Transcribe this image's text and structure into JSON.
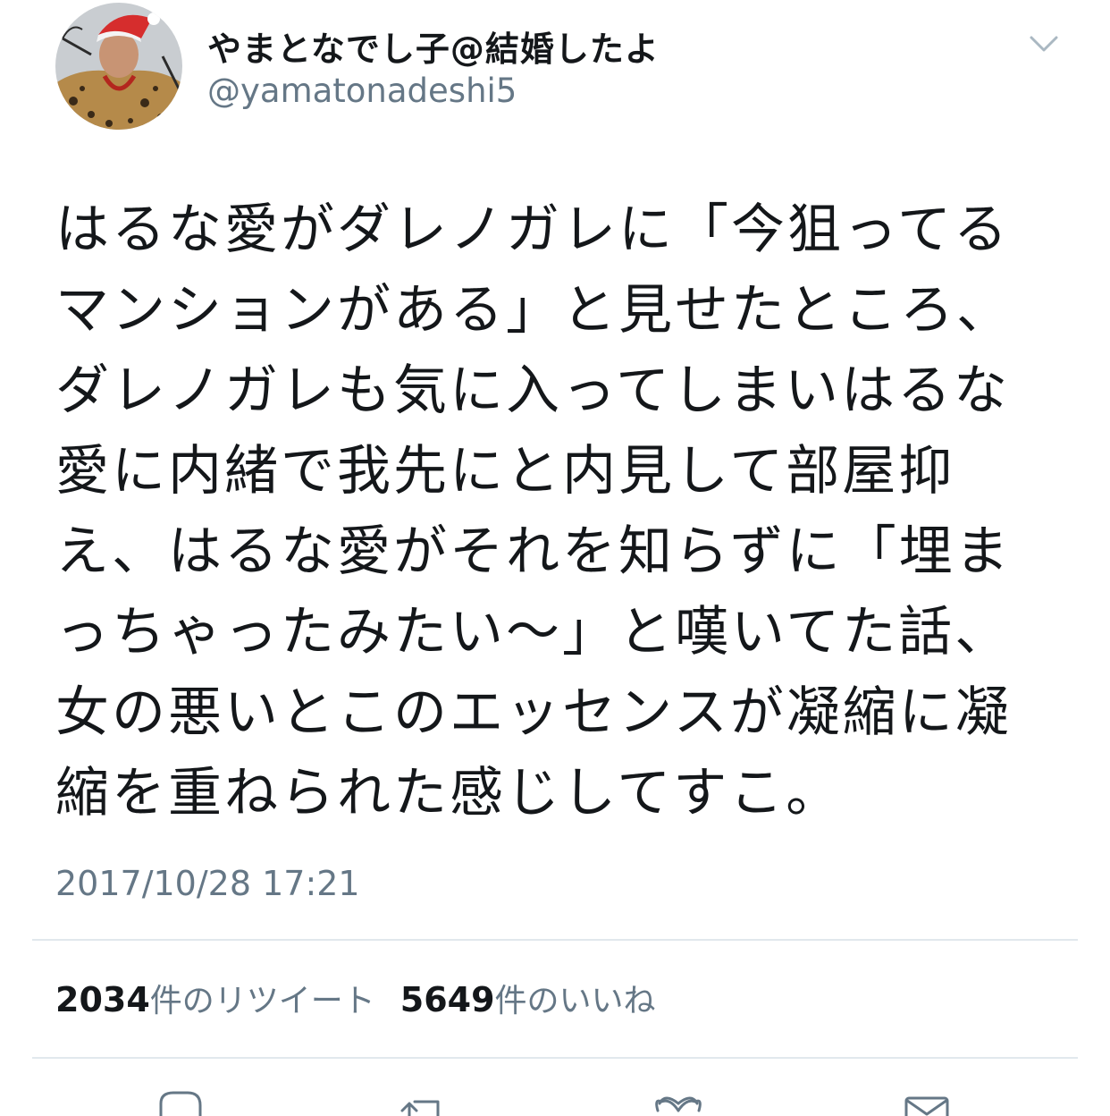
{
  "tweet": {
    "display_name": "やまとなでし子@結婚したよ",
    "handle": "@yamatonadeshi5",
    "text": "はるな愛がダレノガレに「今狙ってるマンションがある」と見せたところ、ダレノガレも気に入ってしまいはるな愛に内緒で我先にと内見して部屋抑え、はるな愛がそれを知らずに「埋まっちゃったみたい〜」と嘆いてた話、女の悪いとこのエッセンスが凝縮に凝縮を重ねられた感じしてすこ。",
    "timestamp": "2017/10/28 17:21"
  },
  "stats": {
    "retweets_count": "2034",
    "retweets_label": "件のリツイート",
    "likes_count": "5649",
    "likes_label": "件のいいね"
  },
  "icons": {
    "menu": "chevron-down-icon",
    "reply": "reply-icon",
    "retweet": "retweet-icon",
    "like": "heart-icon",
    "share": "mail-icon"
  },
  "colors": {
    "text": "#14171a",
    "secondary": "#657786",
    "divider": "#e1e8ed"
  }
}
